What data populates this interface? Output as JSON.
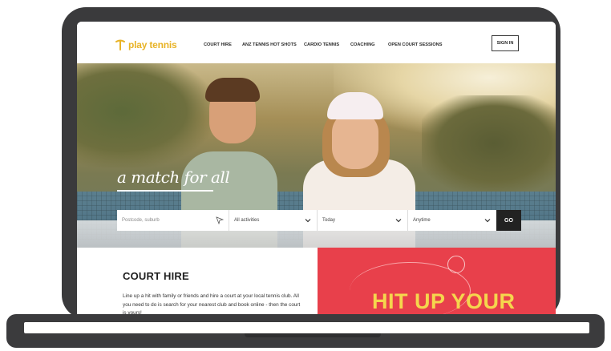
{
  "brand": {
    "logo_text": "play tennis",
    "accent": "#e8b326"
  },
  "nav": {
    "links": [
      "COURT HIRE",
      "ANZ TENNIS HOT SHOTS",
      "CARDIO TENNIS",
      "COACHING",
      "OPEN COURT SESSIONS"
    ],
    "sign_in": "SIGN IN"
  },
  "hero": {
    "tagline": "a match for all"
  },
  "search": {
    "location_placeholder": "Postcode, suburb",
    "activity_value": "All activities",
    "date_value": "Today",
    "time_value": "Anytime",
    "go_label": "GO"
  },
  "court_hire": {
    "title": "COURT HIRE",
    "body": "Line up a hit with family or friends and hire a court at your local tennis club. All you need to do is search for your nearest club and book online - then the court is yours!"
  },
  "promo": {
    "title": "HIT UP YOUR",
    "bg": "#e8404b",
    "title_color": "#f5d64d"
  }
}
